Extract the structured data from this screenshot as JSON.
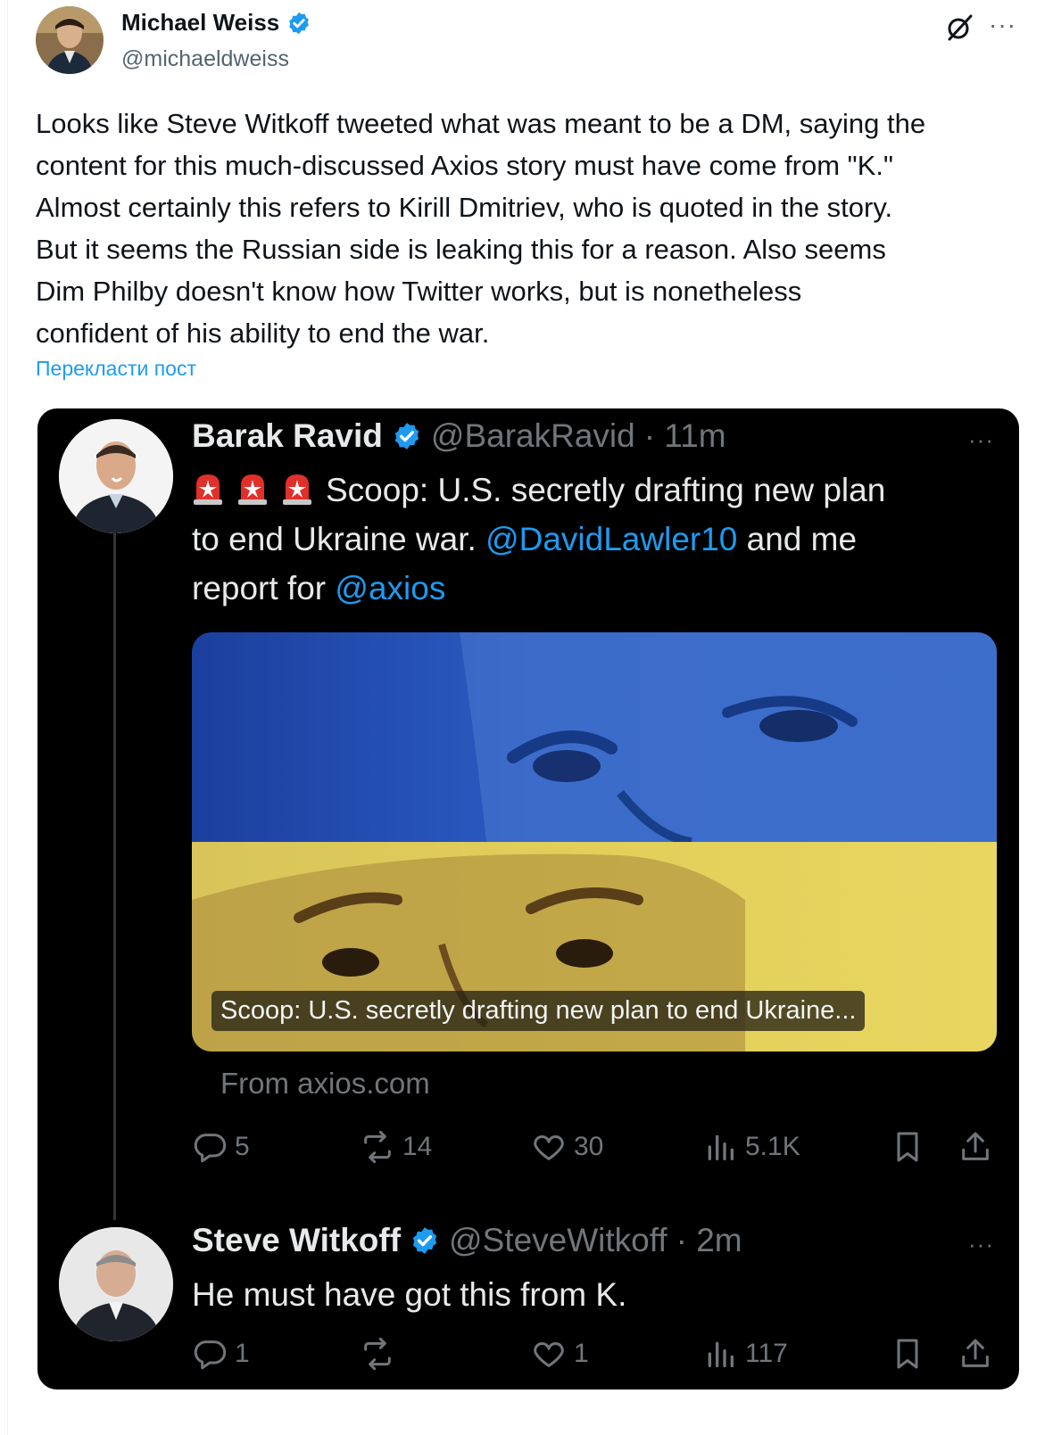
{
  "outer_tweet": {
    "author_name": "Michael Weiss",
    "author_handle": "@michaeldweiss",
    "text_lines": [
      "Looks like Steve Witkoff tweeted what was meant to be a DM, saying the",
      "content for this much-discussed Axios story must have come from \"K.\"",
      "Almost certainly this refers to Kirill Dmitriev, who is quoted in the story.",
      "But it seems the Russian side is leaking this for a reason. Also seems",
      "Dim Philby doesn't know how Twitter works, but is nonetheless",
      "confident of his ability to end the war."
    ],
    "translate_label": "Перекласти пост",
    "more_label": "···"
  },
  "embedded_card": {
    "tweet1": {
      "author_name": "Barak Ravid",
      "author_handle": "@BarakRavid",
      "time": "· 11m",
      "more_label": "···",
      "text_main": "Scoop: U.S. secretly drafting new plan",
      "text_line2_start": "to end Ukraine war. ",
      "mention1": "@DavidLawler10",
      "text_line2_end": " and me",
      "text_line3_start": "report for ",
      "mention2": "@axios",
      "media_caption": "Scoop: U.S. secretly drafting new plan to end Ukraine...",
      "source": "From axios.com",
      "stats": {
        "replies": "5",
        "reposts": "14",
        "likes": "30",
        "views": "5.1K"
      }
    },
    "tweet2": {
      "author_name": "Steve Witkoff",
      "author_handle": "@SteveWitkoff",
      "time": "· 2m",
      "more_label": "···",
      "text": "He must have got this from K.",
      "stats": {
        "replies": "1",
        "reposts": "",
        "likes": "1",
        "views": "117"
      }
    }
  },
  "colors": {
    "verified_blue": "#1d9bf0",
    "link_blue": "#1d9bf0",
    "card_bg": "#000000",
    "muted_text_dark": "#71767b",
    "muted_text_light": "#536471",
    "flag_blue": "#1f5fc8",
    "flag_yellow": "#e2cf5a"
  },
  "icons": [
    "verified-badge-icon",
    "grok-icon",
    "more-icon",
    "siren-icon",
    "reply-icon",
    "repost-icon",
    "like-icon",
    "views-icon",
    "bookmark-icon",
    "share-icon"
  ]
}
